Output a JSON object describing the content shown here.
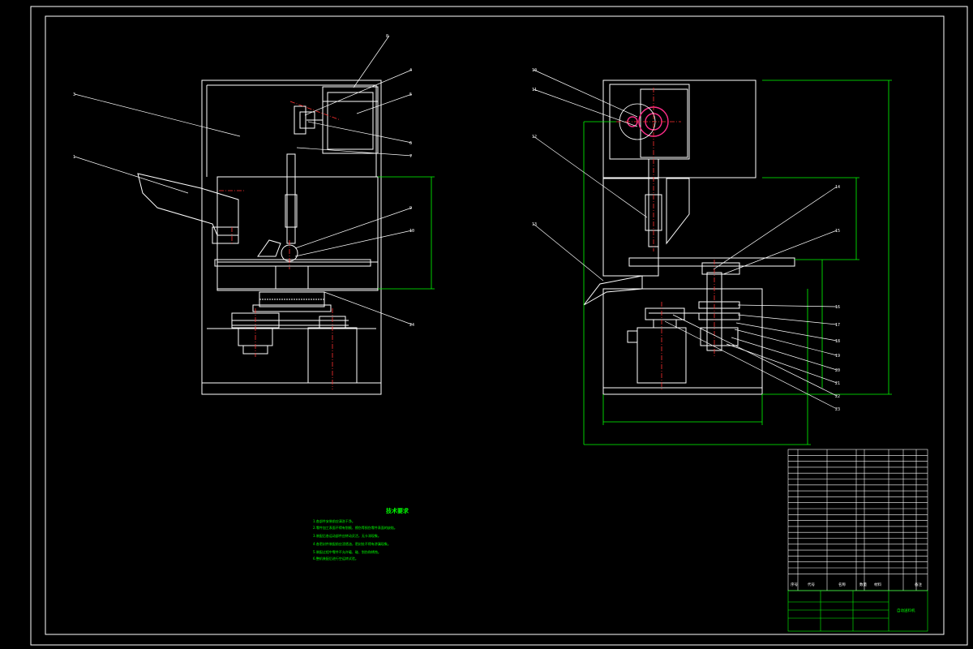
{
  "colors": {
    "background": "#000000",
    "outline": "#ffffff",
    "dimension": "#00ff00",
    "centerline": "#ff3030",
    "highlight": "#ff2d8a"
  },
  "left_view_callouts": [
    "8",
    "4",
    "5",
    "6",
    "7",
    "3",
    "1",
    "9",
    "10",
    "24"
  ],
  "right_view_callouts": [
    "10",
    "11",
    "12",
    "13",
    "14",
    "15",
    "16",
    "17",
    "18",
    "19",
    "20",
    "21",
    "22",
    "23"
  ],
  "notes": {
    "title": "技术要求",
    "lines": [
      "1.各部件安装前应清洗干净。",
      "2.零件加工表面不得有划痕、擦伤等损伤零件表面的缺陷。",
      "3.装配后各运动部件应转动灵活，无卡滞现象。",
      "4.各密封件装配前应浸透油，密封处不得有渗漏现象。",
      "5.装配过程中零件不允许磕、碰、划伤和锈蚀。",
      "6.整机装配后进行空运转试验。"
    ]
  },
  "title_block": {
    "drawing_name": "自动送料机",
    "header_labels": [
      "序号",
      "代号",
      "名称",
      "数量",
      "材料",
      "备注"
    ]
  }
}
